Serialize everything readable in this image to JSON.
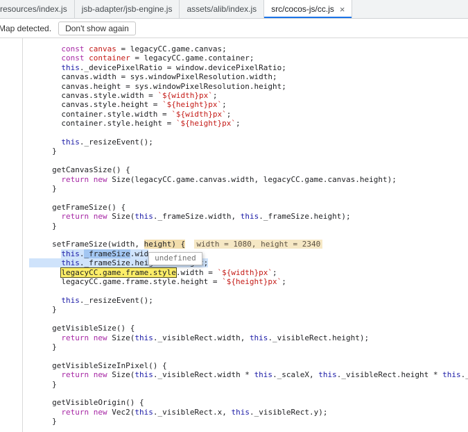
{
  "tabs": {
    "items": [
      {
        "label": "resources/index.js",
        "active": false
      },
      {
        "label": "jsb-adapter/jsb-engine.js",
        "active": false
      },
      {
        "label": "assets/alib/index.js",
        "active": false
      },
      {
        "label": "src/cocos-js/cc.js",
        "active": true,
        "close_icon": "×"
      }
    ]
  },
  "infobar": {
    "message": "Map detected.",
    "button_label": "Don't show again"
  },
  "colors": {
    "accent_blue": "#1a73e8",
    "keyword": "#a626a4",
    "this_keyword": "#1a1aa6",
    "string": "#c41a16",
    "selection_light": "#cfe3fb",
    "selection_dark": "#a2c6f2",
    "paused_tan": "#f2ddac",
    "search_yellow": "#fdee68"
  },
  "code": {
    "lines": [
      [
        [
          "p",
          "       "
        ],
        [
          "k",
          "const"
        ],
        [
          "p",
          " "
        ],
        [
          "d",
          "canvas"
        ],
        [
          "p",
          " = legacyCC.game.canvas;"
        ]
      ],
      [
        [
          "p",
          "       "
        ],
        [
          "k",
          "const"
        ],
        [
          "p",
          " "
        ],
        [
          "d",
          "container"
        ],
        [
          "p",
          " = legacyCC.game.container;"
        ]
      ],
      [
        [
          "p",
          "       "
        ],
        [
          "t",
          "this"
        ],
        [
          "p",
          "._devicePixelRatio = window.devicePixelRatio;"
        ]
      ],
      [
        [
          "p",
          "       canvas.width = sys.windowPixelResolution.width;"
        ]
      ],
      [
        [
          "p",
          "       canvas.height = sys.windowPixelResolution.height;"
        ]
      ],
      [
        [
          "p",
          "       canvas.style.width = "
        ],
        [
          "s",
          "`${width}px`"
        ],
        [
          "p",
          ";"
        ]
      ],
      [
        [
          "p",
          "       canvas.style.height = "
        ],
        [
          "s",
          "`${height}px`"
        ],
        [
          "p",
          ";"
        ]
      ],
      [
        [
          "p",
          "       container.style.width = "
        ],
        [
          "s",
          "`${width}px`"
        ],
        [
          "p",
          ";"
        ]
      ],
      [
        [
          "p",
          "       container.style.height = "
        ],
        [
          "s",
          "`${height}px`"
        ],
        [
          "p",
          ";"
        ]
      ],
      [],
      [
        [
          "p",
          "       "
        ],
        [
          "t",
          "this"
        ],
        [
          "p",
          "._resizeEvent();"
        ]
      ],
      [
        [
          "p",
          "     }"
        ]
      ],
      [],
      [
        [
          "p",
          "     getCanvasSize() {"
        ]
      ],
      [
        [
          "p",
          "       "
        ],
        [
          "k",
          "return"
        ],
        [
          "p",
          " "
        ],
        [
          "k",
          "new"
        ],
        [
          "p",
          " Size(legacyCC.game.canvas.width, legacyCC.game.canvas.height);"
        ]
      ],
      [
        [
          "p",
          "     }"
        ]
      ],
      [],
      [
        [
          "p",
          "     getFrameSize() {"
        ]
      ],
      [
        [
          "p",
          "       "
        ],
        [
          "k",
          "return"
        ],
        [
          "p",
          " "
        ],
        [
          "k",
          "new"
        ],
        [
          "p",
          " Size("
        ],
        [
          "t",
          "this"
        ],
        [
          "p",
          "._frameSize.width, "
        ],
        [
          "t",
          "this"
        ],
        [
          "p",
          "._frameSize.height);"
        ]
      ],
      [
        [
          "p",
          "     }"
        ]
      ],
      [],
      [
        [
          "p",
          "     setFrameSize(width, "
        ],
        [
          "tan",
          "height) {"
        ],
        [
          "p",
          "  "
        ],
        [
          "eval",
          "width = 1080, height = 2340"
        ]
      ],
      [
        [
          "p",
          "       "
        ],
        [
          "t lsel",
          "this"
        ],
        [
          "p lsel",
          "."
        ],
        [
          "p dsel",
          "_frameSize"
        ],
        [
          "p lsel",
          ".wid"
        ],
        [
          "tooltip",
          "undefined"
        ]
      ],
      [
        [
          "p lsel",
          "       "
        ],
        [
          "t lsel",
          "this"
        ],
        [
          "p lsel",
          "._frameSize.height = height;"
        ]
      ],
      [
        [
          "p",
          "       "
        ],
        [
          "yellow",
          "legacyCC.game.frame.style"
        ],
        [
          "p",
          ".width = "
        ],
        [
          "s",
          "`${width}px`"
        ],
        [
          "p",
          ";"
        ]
      ],
      [
        [
          "p",
          "       legacyCC.game.frame.style.height = "
        ],
        [
          "s",
          "`${height}px`"
        ],
        [
          "p",
          ";"
        ]
      ],
      [],
      [
        [
          "p",
          "       "
        ],
        [
          "t",
          "this"
        ],
        [
          "p",
          "._resizeEvent();"
        ]
      ],
      [
        [
          "p",
          "     }"
        ]
      ],
      [],
      [
        [
          "p",
          "     getVisibleSize() {"
        ]
      ],
      [
        [
          "p",
          "       "
        ],
        [
          "k",
          "return"
        ],
        [
          "p",
          " "
        ],
        [
          "k",
          "new"
        ],
        [
          "p",
          " Size("
        ],
        [
          "t",
          "this"
        ],
        [
          "p",
          "._visibleRect.width, "
        ],
        [
          "t",
          "this"
        ],
        [
          "p",
          "._visibleRect.height);"
        ]
      ],
      [
        [
          "p",
          "     }"
        ]
      ],
      [],
      [
        [
          "p",
          "     getVisibleSizeInPixel() {"
        ]
      ],
      [
        [
          "p",
          "       "
        ],
        [
          "k",
          "return"
        ],
        [
          "p",
          " "
        ],
        [
          "k",
          "new"
        ],
        [
          "p",
          " Size("
        ],
        [
          "t",
          "this"
        ],
        [
          "p",
          "._visibleRect.width * "
        ],
        [
          "t",
          "this"
        ],
        [
          "p",
          "._scaleX, "
        ],
        [
          "t",
          "this"
        ],
        [
          "p",
          "._visibleRect.height * "
        ],
        [
          "t",
          "this"
        ],
        [
          "p",
          "._scaleY);"
        ]
      ],
      [
        [
          "p",
          "     }"
        ]
      ],
      [],
      [
        [
          "p",
          "     getVisibleOrigin() {"
        ]
      ],
      [
        [
          "p",
          "       "
        ],
        [
          "k",
          "return"
        ],
        [
          "p",
          " "
        ],
        [
          "k",
          "new"
        ],
        [
          "p",
          " Vec2("
        ],
        [
          "t",
          "this"
        ],
        [
          "p",
          "._visibleRect.x, "
        ],
        [
          "t",
          "this"
        ],
        [
          "p",
          "._visibleRect.y);"
        ]
      ],
      [
        [
          "p",
          "     }"
        ]
      ]
    ]
  }
}
